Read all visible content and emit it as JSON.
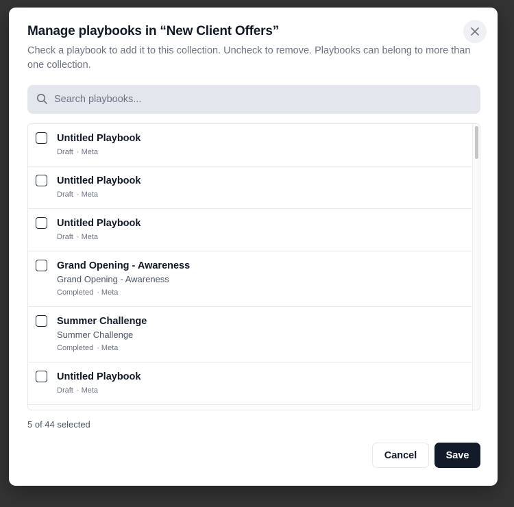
{
  "dialog": {
    "title": "Manage playbooks in “New Client Offers”",
    "description": "Check a playbook to add it to this collection. Uncheck to remove. Playbooks can belong to more than one collection.",
    "close_icon": "close-icon"
  },
  "search": {
    "placeholder": "Search playbooks...",
    "value": "",
    "icon": "search-icon"
  },
  "playbooks": [
    {
      "title": "Untitled Playbook",
      "subtitle": "",
      "status": "Draft",
      "platform": "· Meta",
      "checked": false
    },
    {
      "title": "Untitled Playbook",
      "subtitle": "",
      "status": "Draft",
      "platform": "· Meta",
      "checked": false
    },
    {
      "title": "Untitled Playbook",
      "subtitle": "",
      "status": "Draft",
      "platform": "· Meta",
      "checked": false
    },
    {
      "title": "Grand Opening - Awareness",
      "subtitle": "Grand Opening - Awareness",
      "status": "Completed",
      "platform": "· Meta",
      "checked": false
    },
    {
      "title": "Summer Challenge",
      "subtitle": "Summer Challenge",
      "status": "Completed",
      "platform": "· Meta",
      "checked": false
    },
    {
      "title": "Untitled Playbook",
      "subtitle": "",
      "status": "Draft",
      "platform": "· Meta",
      "checked": false
    }
  ],
  "selection": {
    "summary": "5 of 44 selected"
  },
  "footer": {
    "cancel_label": "Cancel",
    "save_label": "Save"
  },
  "colors": {
    "primary_button": "#131a2a",
    "backdrop": "#343434",
    "search_bg": "#e3e7ed"
  }
}
